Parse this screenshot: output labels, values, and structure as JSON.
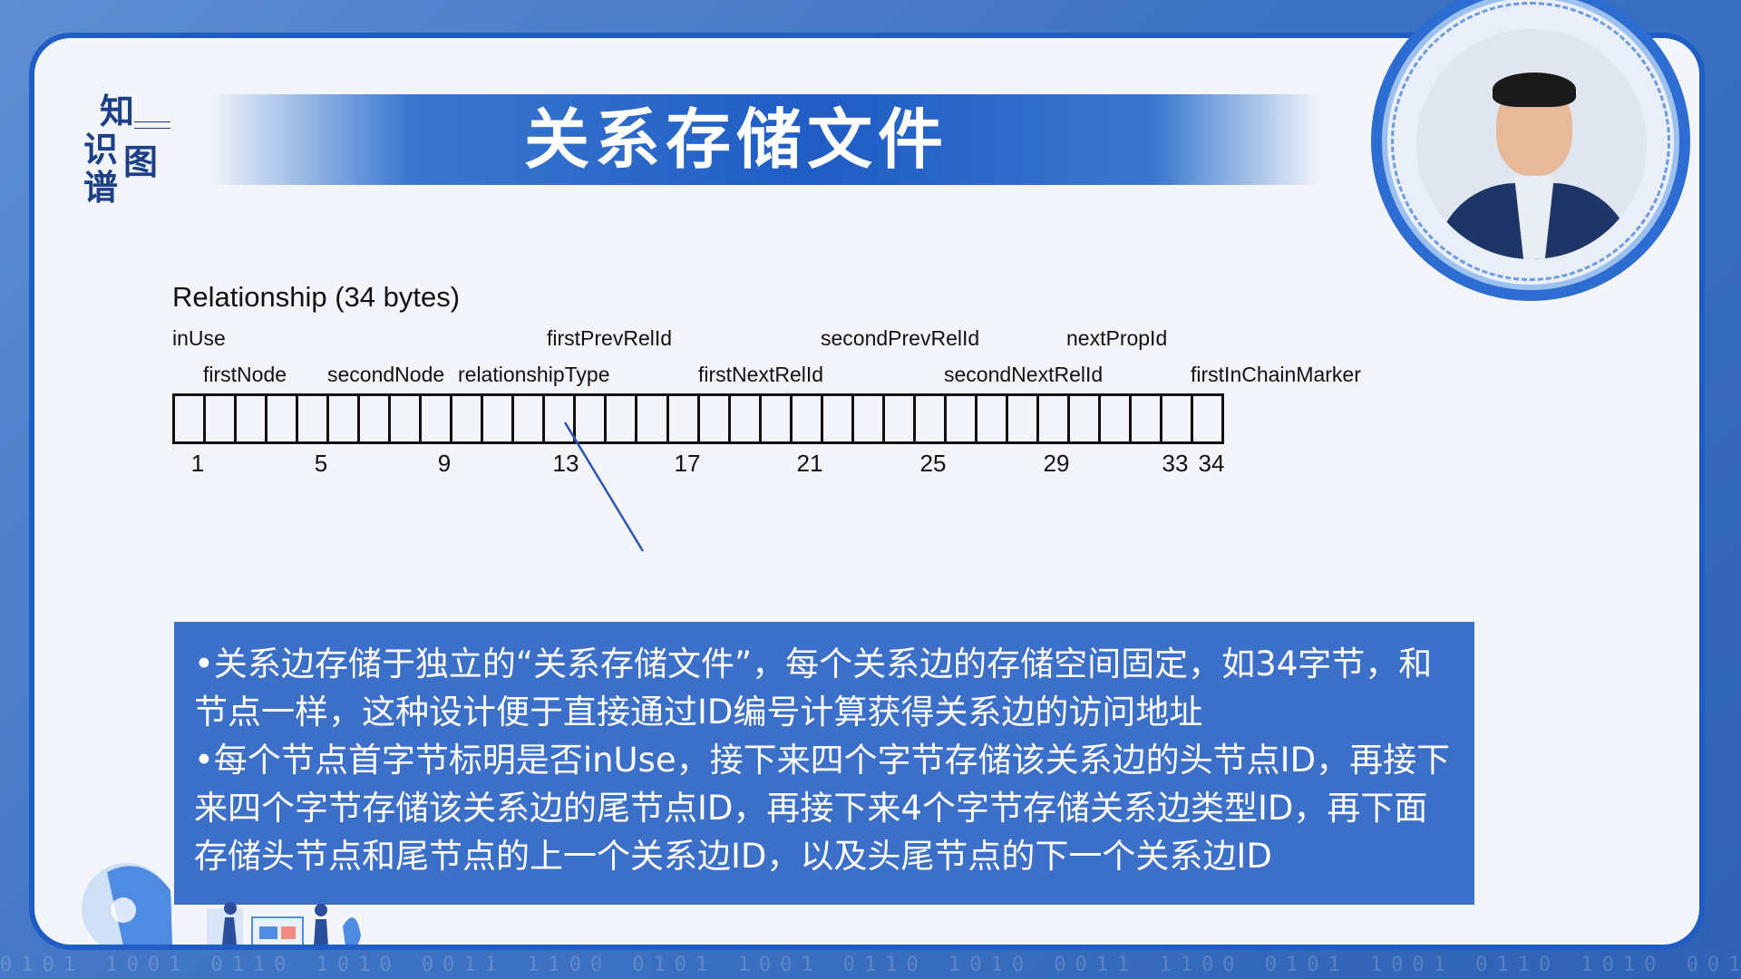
{
  "logo": {
    "chars": [
      "知",
      "识",
      "图",
      "谱"
    ]
  },
  "slide": {
    "title": "关系存储文件"
  },
  "diagram": {
    "caption": "Relationship (34 bytes)",
    "total_bytes": 34,
    "fields_top_row": [
      "inUse",
      "firstPrevRelId",
      "secondPrevRelId",
      "nextPropId"
    ],
    "fields_bottom_row": [
      "firstNode",
      "secondNode",
      "relationshipType",
      "firstNextRelId",
      "secondNextRelId",
      "firstInChainMarker"
    ],
    "tick_labels": [
      "1",
      "5",
      "9",
      "13",
      "17",
      "21",
      "25",
      "29",
      "33",
      "34"
    ]
  },
  "description": {
    "paragraphs": [
      "•关系边存储于独立的“关系存储文件”，每个关系边的存储空间固定，如34字节，和节点一样，这种设计便于直接通过ID编号计算获得关系边的访问地址",
      "•每个节点首字节标明是否inUse，接下来四个字节存储该关系边的头节点ID，再接下来四个字节存储该关系边的尾节点ID，再接下来4个字节存储关系边类型ID，再下面存储头节点和尾节点的上一个关系边ID，以及头尾节点的下一个关系边ID"
    ]
  },
  "colors": {
    "accent": "#1f5cc4",
    "box": "#3c6fc7",
    "panel": "#f3f5fa"
  },
  "icons": [
    "presenter-portrait",
    "robot-head-illustration",
    "people-illustration"
  ]
}
